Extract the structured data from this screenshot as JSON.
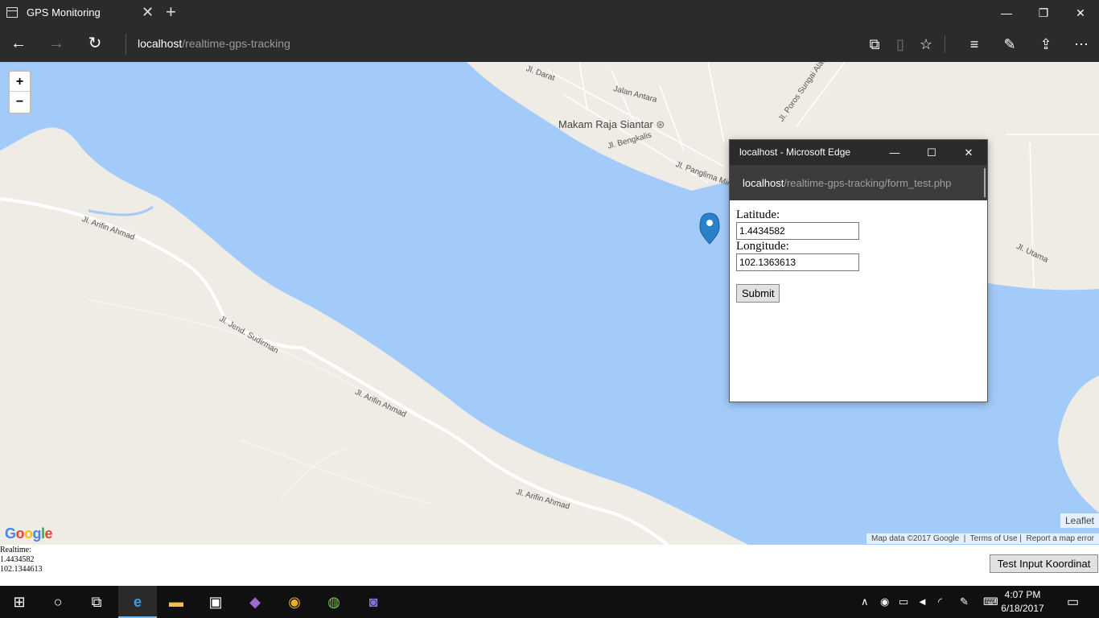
{
  "browser": {
    "tab_title": "GPS Monitoring",
    "address_host": "localhost",
    "address_path": "/realtime-gps-tracking"
  },
  "map": {
    "zoom_in": "+",
    "zoom_out": "−",
    "labels": {
      "makam": "Makam Raja Siantar",
      "arifin1": "Jl. Arifin Ahmad",
      "arifin2": "Jl. Arifin Ahmad",
      "arifin3": "Jl. Arifin Ahmad",
      "sudirman": "Jl. Jend. Sudirman",
      "jalan_antara": "Jalan Antara",
      "bengkalis": "Jl. Bengkalis",
      "panglima": "Jl. Panglima Mina",
      "darat": "Jl. Darat",
      "poros": "Jl. Poros Sungai Alam",
      "utama": "Jl. Utama"
    },
    "attribution": {
      "leaflet": "Leaflet",
      "map_data": "Map data ©2017 Google",
      "terms": "Terms of Use",
      "report": "Report a map error"
    },
    "google_logo": [
      "G",
      "o",
      "o",
      "g",
      "l",
      "e"
    ]
  },
  "popup": {
    "title": "localhost - Microsoft Edge",
    "address_host": "localhost",
    "address_path": "/realtime-gps-tracking/form_test.php",
    "latitude_label": "Latitude:",
    "latitude_value": "1.4434582",
    "longitude_label": "Longitude:",
    "longitude_value": "102.1363613",
    "submit_label": "Submit"
  },
  "realtime": {
    "label": "Realtime:",
    "latitude": "1.4434582",
    "longitude": "102.1344613"
  },
  "test_button_label": "Test Input Koordinat",
  "taskbar": {
    "time": "4:07 PM",
    "date": "6/18/2017"
  }
}
